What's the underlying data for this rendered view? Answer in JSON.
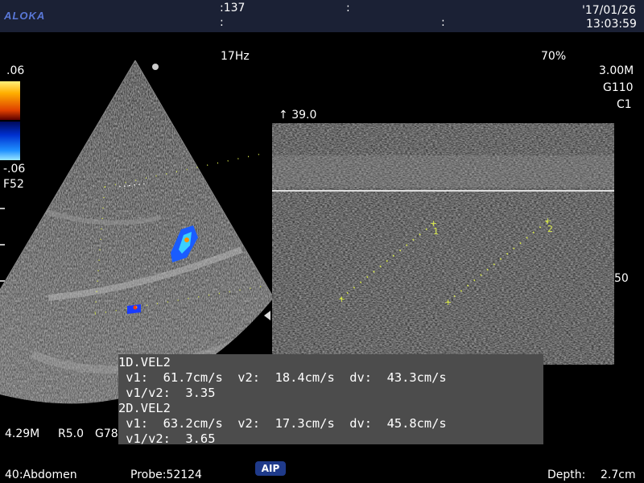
{
  "header": {
    "brand": "ALOKA",
    "center_value": ":137",
    "colon_a": ":",
    "colon_b": ":",
    "colon_c": ":",
    "date": "'17/01/26",
    "time": "13:03:59"
  },
  "params": {
    "frame_rate": "17Hz",
    "power": "70%",
    "depth_range": "3.00M",
    "gain": "G110",
    "contrast": "C1",
    "color_scale_top": ".06",
    "color_scale_bottom": "-.06",
    "filter": "F52",
    "velocity_scale_top": "39.0",
    "velocity_scale_mark": "50",
    "bmode_freq": "4.29M",
    "bmode_r": "R5.0",
    "bmode_g": "G78"
  },
  "measurements": {
    "line1": "1D.VEL2",
    "line2": " v1:  61.7cm/s  v2:  18.4cm/s  dv:  43.3cm/s",
    "line3": " v1/v2:  3.35",
    "line4": "2D.VEL2",
    "line5": " v1:  63.2cm/s  v2:  17.3cm/s  dv:  45.8cm/s",
    "line6": " v1/v2:  3.65"
  },
  "footer": {
    "preset": "40:Abdomen",
    "probe": "Probe:52124",
    "aip_label": "AIP",
    "depth_label": "Depth:",
    "depth_value": "2.7cm"
  },
  "markers": {
    "cursor_1": "1",
    "cursor_2": "2"
  },
  "colors": {
    "topbar": "#1b2135",
    "caliper": "#d8e84a",
    "measurement_box": "#4c4c4c"
  }
}
